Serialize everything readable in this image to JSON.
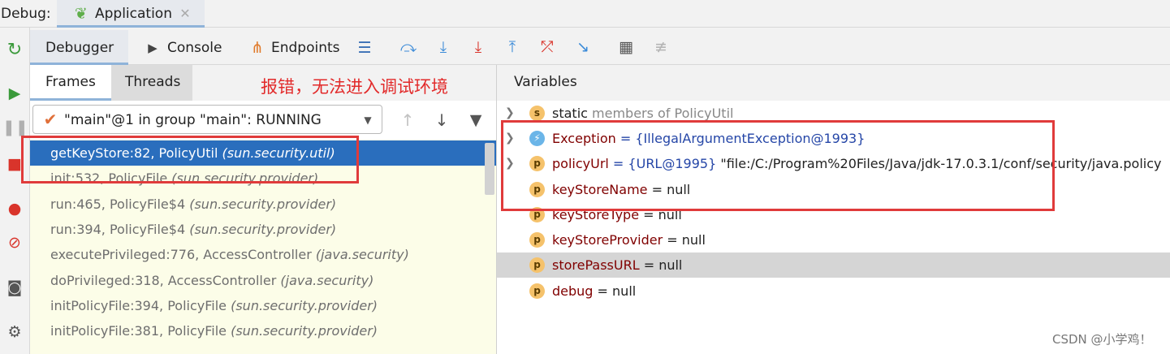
{
  "topbar": {
    "debug_label": "Debug:",
    "tab_label": "Application"
  },
  "toolbar": {
    "tabs": [
      {
        "label": "Debugger"
      },
      {
        "label": "Console"
      },
      {
        "label": "Endpoints"
      }
    ]
  },
  "frames_panel": {
    "tabs": [
      {
        "label": "Frames"
      },
      {
        "label": "Threads"
      }
    ],
    "thread_select": "\"main\"@1 in group \"main\": RUNNING",
    "frames": [
      {
        "method": "getKeyStore:82, PolicyUtil",
        "pkg": "(sun.security.util)"
      },
      {
        "method": "init:532, PolicyFile",
        "pkg": "(sun.security.provider)"
      },
      {
        "method": "run:465, PolicyFile$4",
        "pkg": "(sun.security.provider)"
      },
      {
        "method": "run:394, PolicyFile$4",
        "pkg": "(sun.security.provider)"
      },
      {
        "method": "executePrivileged:776, AccessController",
        "pkg": "(java.security)"
      },
      {
        "method": "doPrivileged:318, AccessController",
        "pkg": "(java.security)"
      },
      {
        "method": "initPolicyFile:394, PolicyFile",
        "pkg": "(sun.security.provider)"
      },
      {
        "method": "initPolicyFile:381, PolicyFile",
        "pkg": "(sun.security.provider)"
      }
    ]
  },
  "annotation": "报错，无法进入调试环境",
  "variables_panel": {
    "title": "Variables",
    "rows": [
      {
        "badge": "s",
        "name": "static",
        "rest": "members of PolicyUtil"
      },
      {
        "badge": "⚡",
        "name": "Exception",
        "eq": " = ",
        "ref": "{IllegalArgumentException@1993}"
      },
      {
        "badge": "p",
        "name": "policyUrl",
        "eq": " = ",
        "ref": "{URL@1995}",
        "value": " \"file:/C:/Program%20Files/Java/jdk-17.0.3.1/conf/security/java.policy"
      },
      {
        "badge": "p",
        "name": "keyStoreName",
        "eq": " = null"
      },
      {
        "badge": "p",
        "name": "keyStoreType",
        "eq": " = null"
      },
      {
        "badge": "p",
        "name": "keyStoreProvider",
        "eq": " = null"
      },
      {
        "badge": "p",
        "name": "storePassURL",
        "eq": " = null"
      },
      {
        "badge": "p",
        "name": "debug",
        "eq": " = null"
      }
    ]
  },
  "watermark": "CSDN @小学鸡！",
  "colors": {
    "selection": "#2a6ebd",
    "frames_bg": "#fcfde8",
    "annotation": "#e22a2a"
  }
}
